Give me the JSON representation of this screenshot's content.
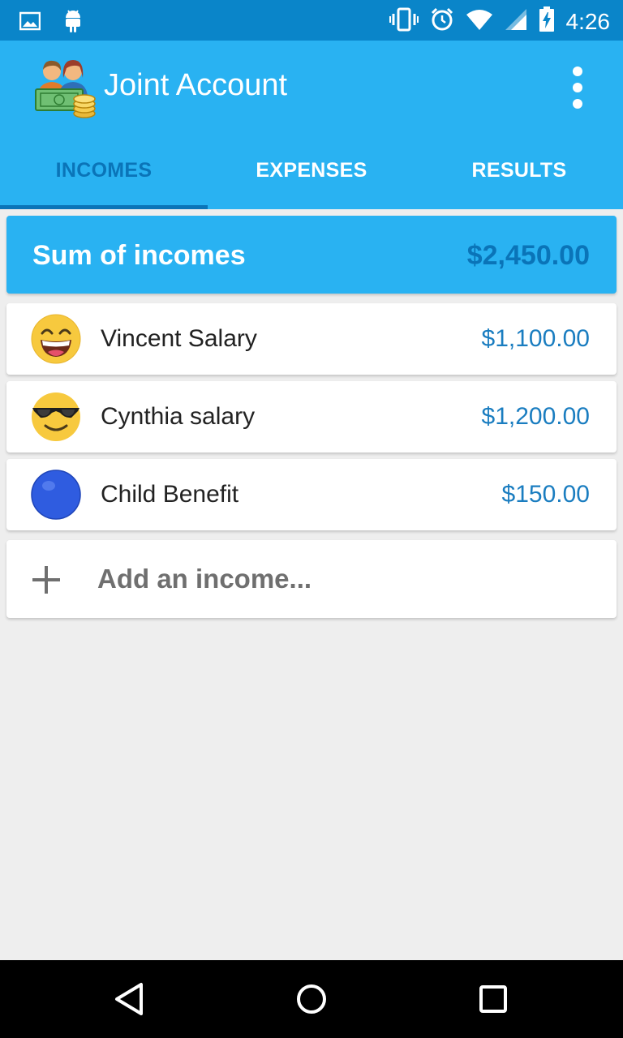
{
  "status_bar": {
    "time": "4:26",
    "left_icons": [
      "image-icon",
      "android-icon"
    ],
    "right_icons": [
      "vibrate-icon",
      "alarm-icon",
      "wifi-icon",
      "signal-icon",
      "battery-icon"
    ]
  },
  "app_bar": {
    "title": "Joint Account",
    "logo_icon": "couple-money-icon",
    "menu_icon": "more-vertical-icon"
  },
  "tabs": [
    {
      "label": "INCOMES",
      "active": true
    },
    {
      "label": "EXPENSES",
      "active": false
    },
    {
      "label": "RESULTS",
      "active": false
    }
  ],
  "summary": {
    "label": "Sum of incomes",
    "value": "$2,450.00"
  },
  "incomes": [
    {
      "name": "Vincent Salary",
      "amount": "$1,100.00",
      "icon": "grinning-face-icon"
    },
    {
      "name": "Cynthia salary",
      "amount": "$1,200.00",
      "icon": "sunglasses-face-icon"
    },
    {
      "name": "Child Benefit",
      "amount": "$150.00",
      "icon": "blue-circle-icon"
    }
  ],
  "add_income": {
    "label": "Add an income...",
    "icon": "plus-icon"
  },
  "nav_bar": {
    "buttons": [
      "back-icon",
      "home-icon",
      "recents-icon"
    ]
  },
  "colors": {
    "primary": "#29B2F2",
    "primary_dark": "#0A85C9",
    "accent_text": "#0A74B8",
    "amount": "#1A7DC0",
    "background": "#EEEEEE"
  }
}
